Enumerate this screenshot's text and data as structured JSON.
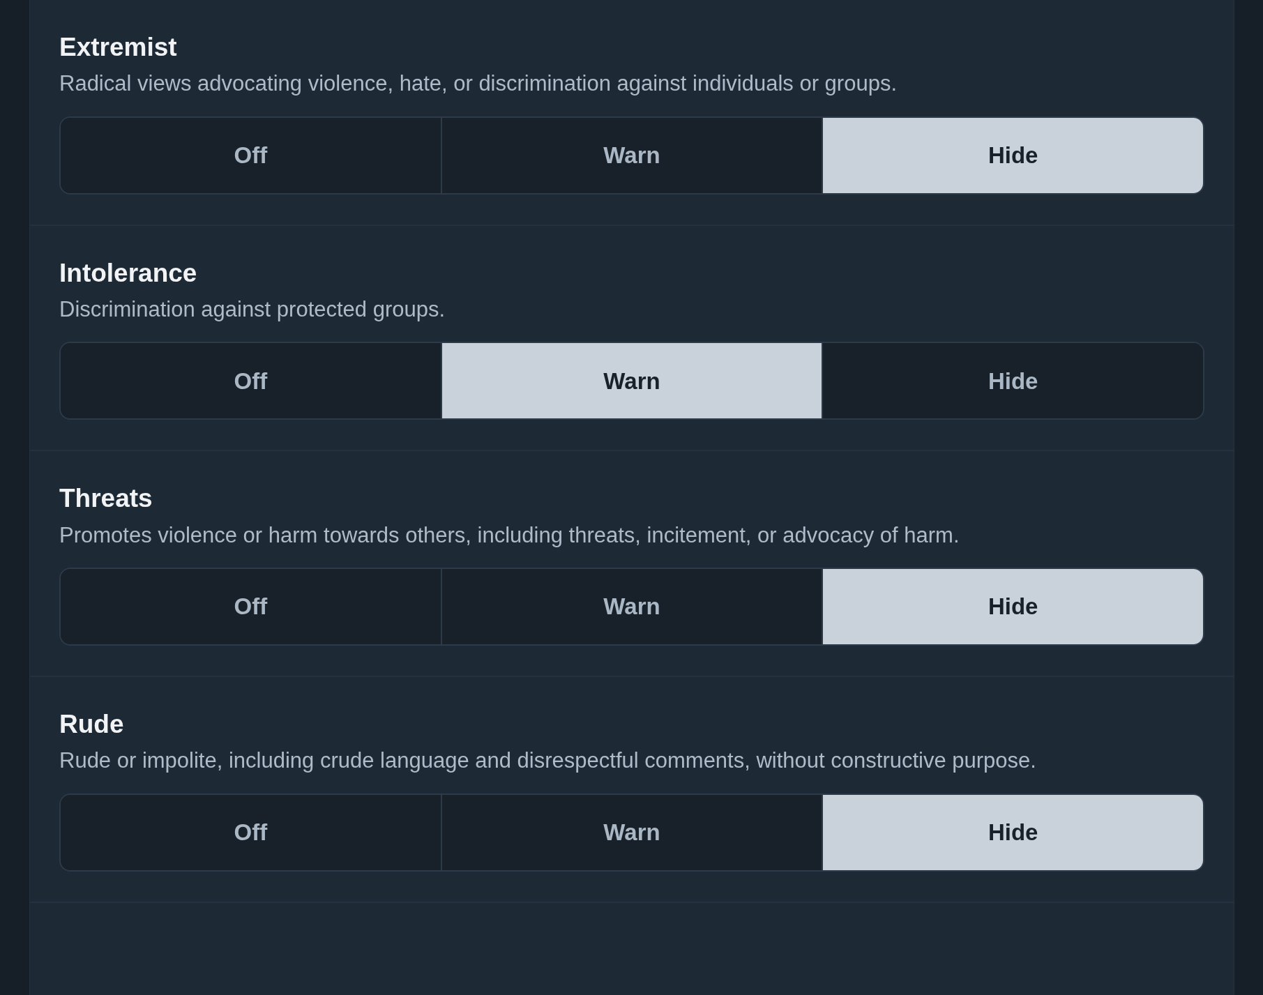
{
  "categories": [
    {
      "title": "Extremist",
      "description": "Radical views advocating violence, hate, or discrimination against individuals or groups.",
      "options": [
        {
          "label": "Off",
          "selected": false
        },
        {
          "label": "Warn",
          "selected": false
        },
        {
          "label": "Hide",
          "selected": true
        }
      ]
    },
    {
      "title": "Intolerance",
      "description": "Discrimination against protected groups.",
      "options": [
        {
          "label": "Off",
          "selected": false
        },
        {
          "label": "Warn",
          "selected": true
        },
        {
          "label": "Hide",
          "selected": false
        }
      ]
    },
    {
      "title": "Threats",
      "description": "Promotes violence or harm towards others, including threats, incitement, or advocacy of harm.",
      "options": [
        {
          "label": "Off",
          "selected": false
        },
        {
          "label": "Warn",
          "selected": false
        },
        {
          "label": "Hide",
          "selected": true
        }
      ]
    },
    {
      "title": "Rude",
      "description": "Rude or impolite, including crude language and disrespectful comments, without constructive purpose.",
      "options": [
        {
          "label": "Off",
          "selected": false
        },
        {
          "label": "Warn",
          "selected": false
        },
        {
          "label": "Hide",
          "selected": true
        }
      ]
    }
  ]
}
